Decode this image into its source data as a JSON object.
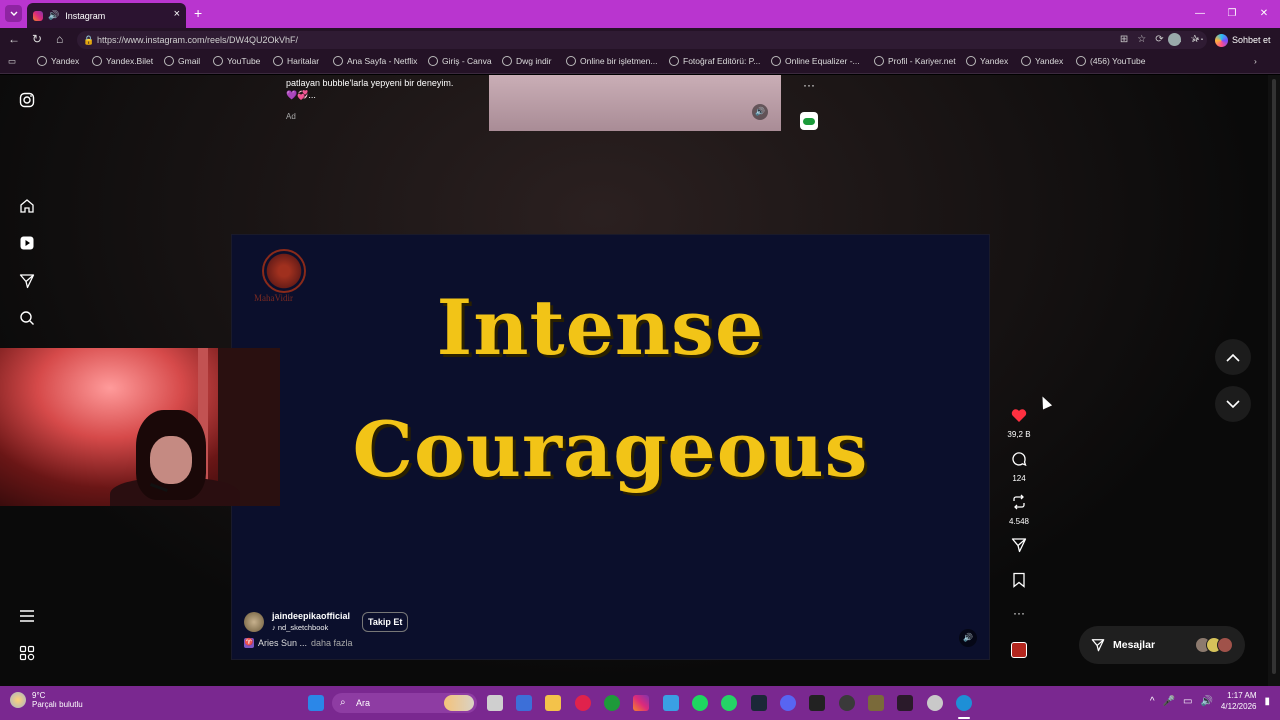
{
  "browser": {
    "tab_title": "Instagram",
    "url": "https://www.instagram.com/reels/DW4QU2OkVhF/",
    "chat_button": "Sohbet et",
    "bookmarks": [
      "Yandex",
      "Yandex.Bilet",
      "Gmail",
      "YouTube",
      "Haritalar",
      "Ana Sayfa - Netflix",
      "Giriş - Canva",
      "Dwg indir",
      "Online bir işletmen...",
      "Fotoğraf Editörü: P...",
      "Online Equalizer -...",
      "Profil - Kariyer.net",
      "Yandex",
      "Yandex",
      "(456) YouTube"
    ]
  },
  "ad": {
    "text_line1": "patlayan bubble'larla yepyeni bir deneyim.",
    "text_line2": "💜💞...",
    "label": "Ad"
  },
  "reel": {
    "logo_text": "MahaVidir",
    "line1": "Intense",
    "line2": "Courageous",
    "username": "jaindeepikaofficial",
    "audio": "nd_sketchbook",
    "follow": "Takip Et",
    "caption": "Aries Sun ...",
    "caption_more": "daha fazla"
  },
  "actions": {
    "likes": "39,2 B",
    "comments": "124",
    "reposts": "4.548"
  },
  "messages": {
    "label": "Mesajlar"
  },
  "taskbar": {
    "temperature": "9°C",
    "weather": "Parçalı bulutlu",
    "search": "Ara",
    "time": "1:17 AM",
    "date": "4/12/2026"
  },
  "colors": {
    "tabbar": "#b935cf",
    "taskbar": "#7a2890",
    "reel_text": "#f2c417",
    "reel_bg": "#0b0f2c",
    "like": "#ff3040"
  }
}
